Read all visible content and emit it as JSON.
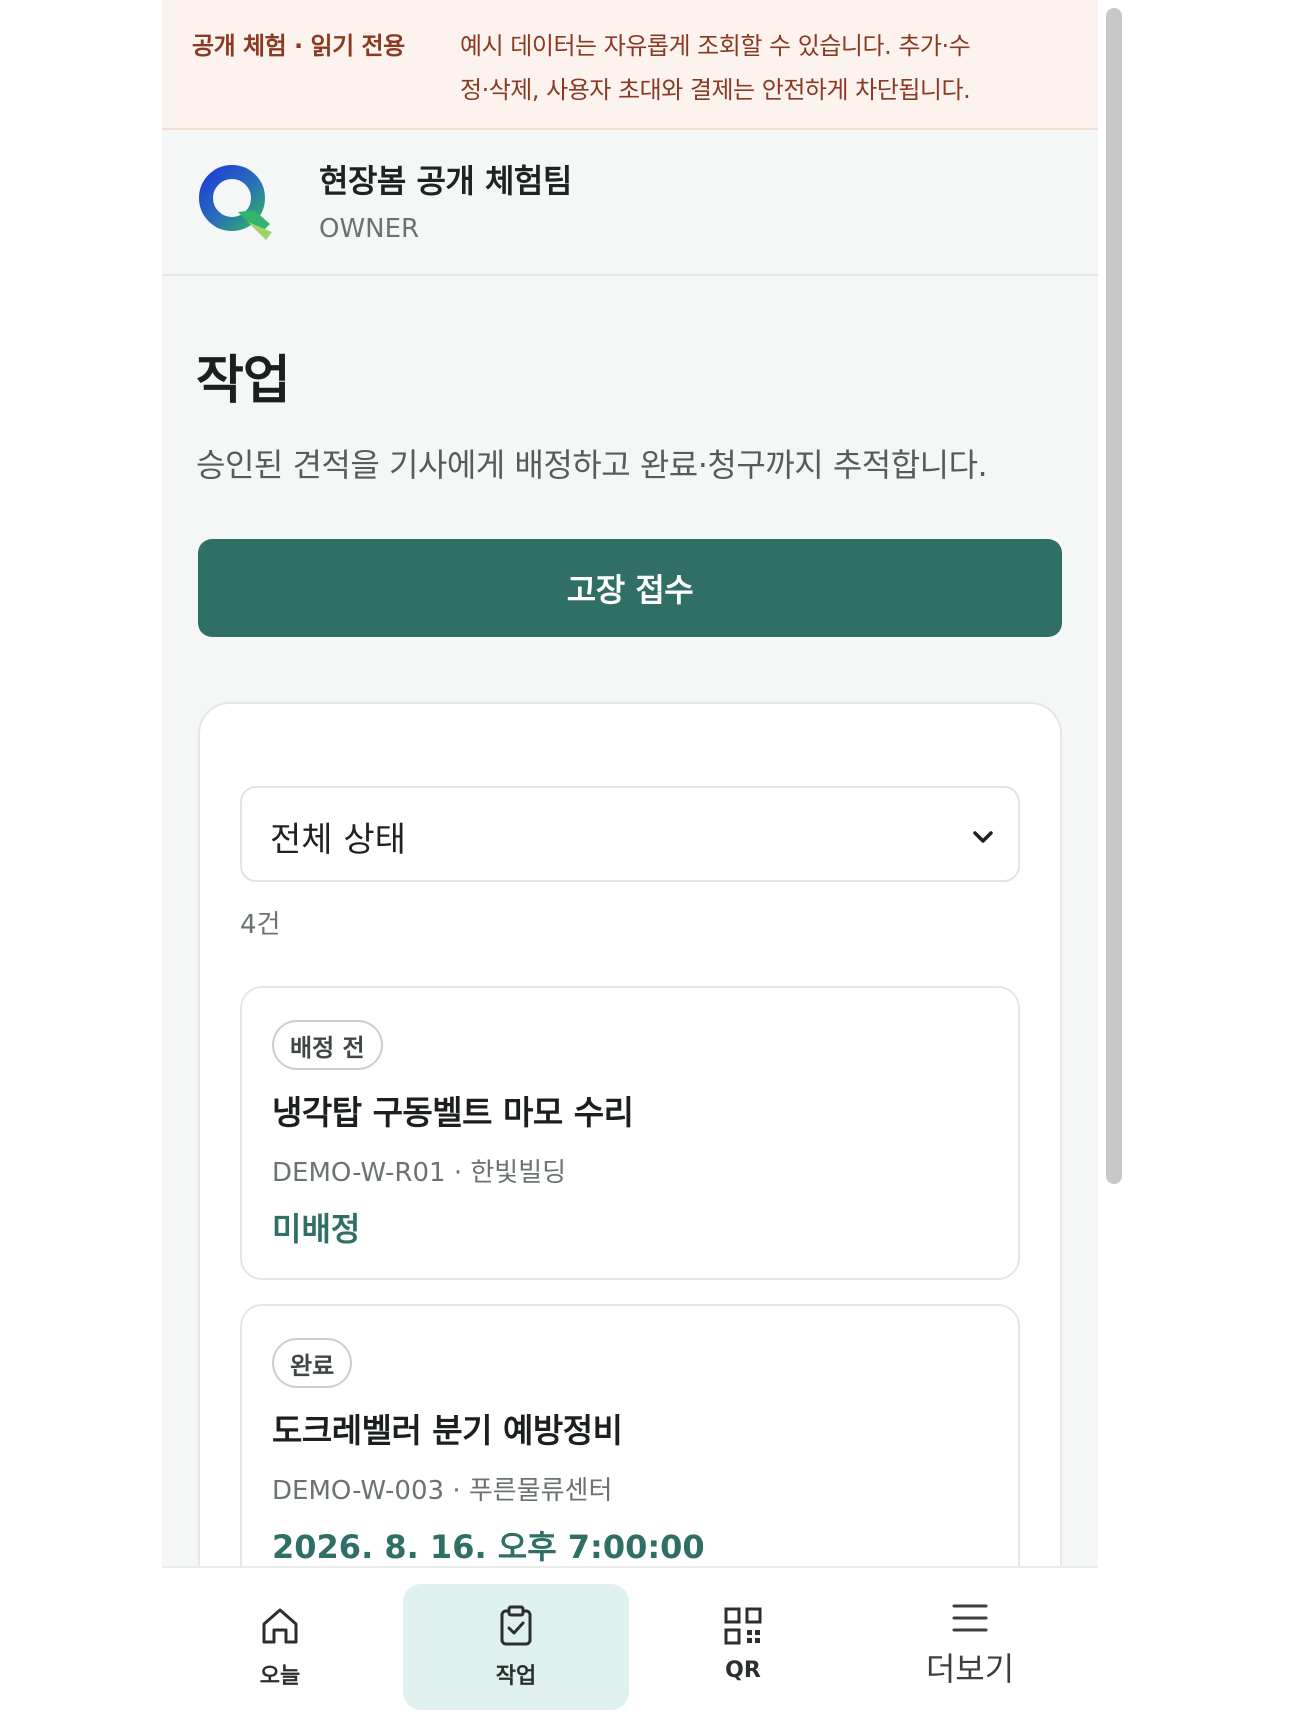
{
  "banner": {
    "tag": "공개 체험 · 읽기 전용",
    "line1": "예시 데이터는 자유롭게 조회할 수 있습니다. 추가·수",
    "line2": "정·삭제, 사용자 초대와 결제는 안전하게 차단됩니다."
  },
  "org": {
    "name": "현장봄 공개 체험팀",
    "role": "OWNER"
  },
  "page": {
    "title": "작업",
    "description": "승인된 견적을 기사에게 배정하고 완료·청구까지 추적합니다.",
    "primary_button": "고장 접수"
  },
  "filter": {
    "selected": "전체 상태",
    "count": "4건"
  },
  "jobs": [
    {
      "badge": "배정 전",
      "title": "냉각탑 구동벨트 마모 수리",
      "meta": "DEMO-W-R01 · 한빛빌딩",
      "status": "미배정"
    },
    {
      "badge": "완료",
      "title": "도크레벨러 분기 예방정비",
      "meta": "DEMO-W-003 · 푸른물류센터",
      "status": "2026. 8. 16. 오후 7:00:00"
    }
  ],
  "tabs": {
    "today": "오늘",
    "jobs": "작업",
    "qr": "QR",
    "more": "더보기"
  },
  "colors": {
    "accent": "#2f6f66",
    "banner_bg": "#fdf3ee",
    "banner_text": "#8a3a22",
    "active_tab_bg": "#dff1ee"
  },
  "icons": {
    "logo": "q-logo-icon",
    "select": "chevron-down-icon",
    "today": "home-icon",
    "jobs": "clipboard-check-icon",
    "qr": "qr-code-icon",
    "more": "menu-icon"
  }
}
